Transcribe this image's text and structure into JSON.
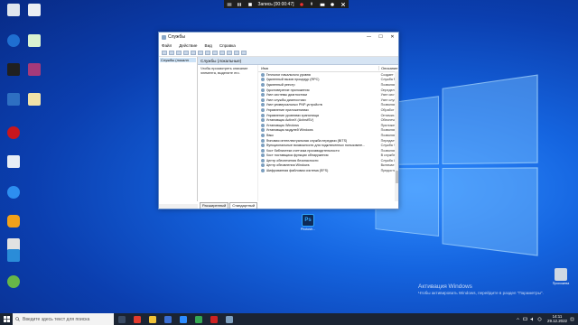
{
  "recording": {
    "label": "Запись [00:00:47]"
  },
  "desktop_icons": [
    {
      "label": "",
      "color": "#dfe6ee"
    },
    {
      "label": "",
      "color": "#eaeef3"
    },
    {
      "label": "",
      "color": "#1f6fd1"
    },
    {
      "label": "",
      "color": "#d9f2d0"
    },
    {
      "label": "",
      "color": "#202020"
    },
    {
      "label": "",
      "color": "#a53a7a"
    },
    {
      "label": "",
      "color": "#2e6fc2"
    },
    {
      "label": "",
      "color": "#f0e2a8"
    },
    {
      "label": "",
      "color": "#c8161d"
    },
    {
      "label": "",
      "color": "#e8eef5"
    },
    {
      "label": "",
      "color": "#2d8ef0"
    },
    {
      "label": "",
      "color": "#f2a11a"
    },
    {
      "label": "",
      "color": "#e2e2e2"
    },
    {
      "label": "",
      "color": "#2a8cd8"
    },
    {
      "label": "",
      "color": "#67b648"
    },
    {
      "label": "",
      "color": "#0e2a57"
    }
  ],
  "window": {
    "title": "Службы",
    "menu": [
      "Файл",
      "Действие",
      "Вид",
      "Справка"
    ],
    "tree_node": "Службы (локалн",
    "panel_header": "Службы (локальные)",
    "description": "Чтобы просмотреть описание элемента, выделите его.",
    "columns": {
      "name": "Имя",
      "description": "Описание"
    },
    "services": [
      {
        "name": "Теплолог начального уровня",
        "desc": "Создает о"
      },
      {
        "name": "Удаленный вызов процедур (RPC)",
        "desc": "Служба RP"
      },
      {
        "name": "Удаленный реестр",
        "desc": "Позволяе"
      },
      {
        "name": "Удостоверение приложения",
        "desc": "Определ"
      },
      {
        "name": "Узел системы диагностики",
        "desc": "Узел сист"
      },
      {
        "name": "Узел службы диагностики",
        "desc": "Узел служ"
      },
      {
        "name": "Узел универсальных PNP-устройств",
        "desc": "Позволяе"
      },
      {
        "name": "Управление приложениями",
        "desc": "Обработ"
      },
      {
        "name": "Управление уровнями хранилища",
        "desc": "Оптимиз"
      },
      {
        "name": "Установщик ActiveX (AxInstSV)",
        "desc": "Обеспече"
      },
      {
        "name": "Установщик Windows",
        "desc": "Приложе"
      },
      {
        "name": "Установщик модулей Windows",
        "desc": "Позволяе"
      },
      {
        "name": "Факс",
        "desc": "Позволяе"
      },
      {
        "name": "Фоновая интеллектуальная служба передачи (BITS)",
        "desc": "Передает"
      },
      {
        "name": "Функциональные возможности для подключенных пользовате...",
        "desc": "Служба Ф"
      },
      {
        "name": "Хост библиотеки счетчика производительности",
        "desc": "Позволяе"
      },
      {
        "name": "Хост поставщика функции обнаружения",
        "desc": "В службе"
      },
      {
        "name": "Центр обеспечения безопасности",
        "desc": "Служба W"
      },
      {
        "name": "Центр обновления Windows",
        "desc": "Включае"
      },
      {
        "name": "Шифрованная файловая система (EFS)",
        "desc": "Предоста"
      }
    ],
    "tabs": [
      "Расширенный",
      "Стандартный"
    ]
  },
  "ps_icon": {
    "letters": "Ps",
    "label": "Photosh..."
  },
  "activation": {
    "title": "Активация Windows",
    "subtitle": "Чтобы активировать Windows, перейдите в раздел \"Параметры\"."
  },
  "taskbar": {
    "search_placeholder": "Введите здесь текст для поиска",
    "time": "14:11",
    "date": "29.12.2022",
    "apps": [
      {
        "name": "task-view",
        "color": "#3a4a63"
      },
      {
        "name": "yandex",
        "color": "#e23b2e"
      },
      {
        "name": "file-explorer",
        "color": "#f0c238"
      },
      {
        "name": "store",
        "color": "#3b6fd4"
      },
      {
        "name": "zoom",
        "color": "#2d8cff"
      },
      {
        "name": "chrome",
        "color": "#34a853"
      },
      {
        "name": "recorder",
        "color": "#c22"
      },
      {
        "name": "services-app",
        "color": "#7d9fbf"
      }
    ]
  },
  "user_folder": {
    "label": "Прохожева"
  }
}
